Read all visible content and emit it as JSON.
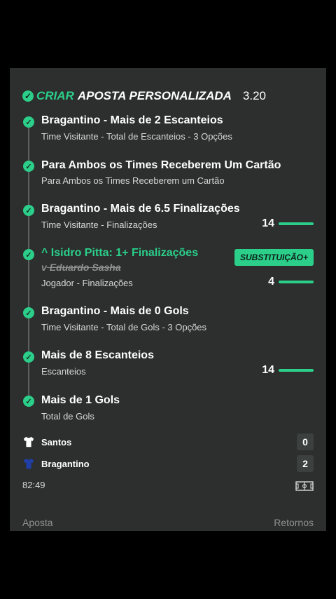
{
  "header": {
    "check_icon": "check-circle-icon",
    "criar": "CRIAR",
    "aposta": "APOSTA PERSONALIZADA",
    "odds": "3.20"
  },
  "legs": [
    {
      "title": "Bragantino - Mais de 2 Escanteios",
      "subtitle": "Time Visitante - Total de Escanteios - 3 Opções"
    },
    {
      "title": "Para Ambos os Times Receberem Um Cartão",
      "subtitle": "Para Ambos os Times Receberem um Cartão"
    },
    {
      "title": "Bragantino - Mais de 6.5 Finalizações",
      "subtitle": "Time Visitante - Finalizações",
      "progress_value": "14"
    },
    {
      "title": "Isidro Pitta: 1+ Finalizações",
      "replaced": "Eduardo Sasha",
      "subtitle": "Jogador - Finalizações",
      "progress_value": "4",
      "badge": "SUBSTITUIÇÃO+"
    },
    {
      "title": "Bragantino - Mais de 0 Gols",
      "subtitle": "Time Visitante - Total de Gols - 3 Opções"
    },
    {
      "title": "Mais de 8 Escanteios",
      "subtitle": "Escanteios",
      "progress_value": "14"
    },
    {
      "title": "Mais de 1 Gols",
      "subtitle": "Total de Gols"
    }
  ],
  "match": {
    "teams": [
      {
        "name": "Santos",
        "score": "0",
        "shirt_color": "#ffffff"
      },
      {
        "name": "Bragantino",
        "score": "2",
        "shirt_color": "#1f3fa6"
      }
    ],
    "time": "82:49"
  },
  "footer": {
    "left": "Aposta",
    "right": "Retornos"
  },
  "colors": {
    "accent": "#2bcf8a",
    "card_bg": "#2c2f2e",
    "page_bg": "#000000"
  }
}
